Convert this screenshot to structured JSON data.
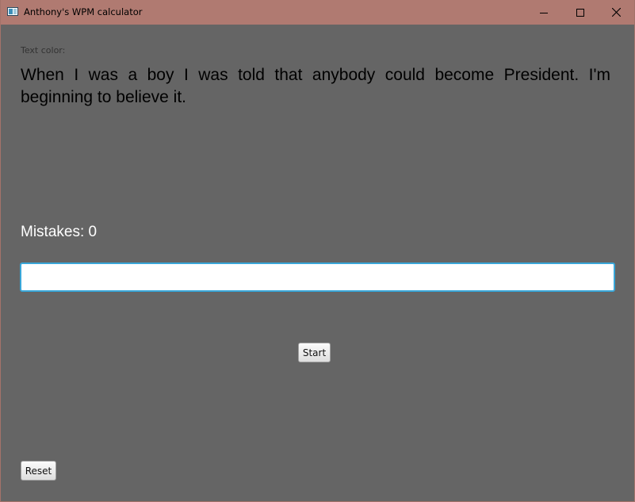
{
  "window": {
    "title": "Anthony's WPM calculator",
    "titlebar_color": "#b07a71",
    "background_color": "#656565",
    "controls": {
      "minimize_icon": "minimize-icon",
      "maximize_icon": "maximize-icon",
      "close_icon": "close-icon"
    }
  },
  "main": {
    "text_color_label": "Text color:",
    "quote": "When I was a boy I was told that anybody could become President. I'm beginning to believe it.",
    "mistakes_label": "Mistakes: ",
    "mistakes_count": "0",
    "input_value": "",
    "input_focus_color": "#39a6d8",
    "start_label": "Start",
    "reset_label": "Reset"
  }
}
